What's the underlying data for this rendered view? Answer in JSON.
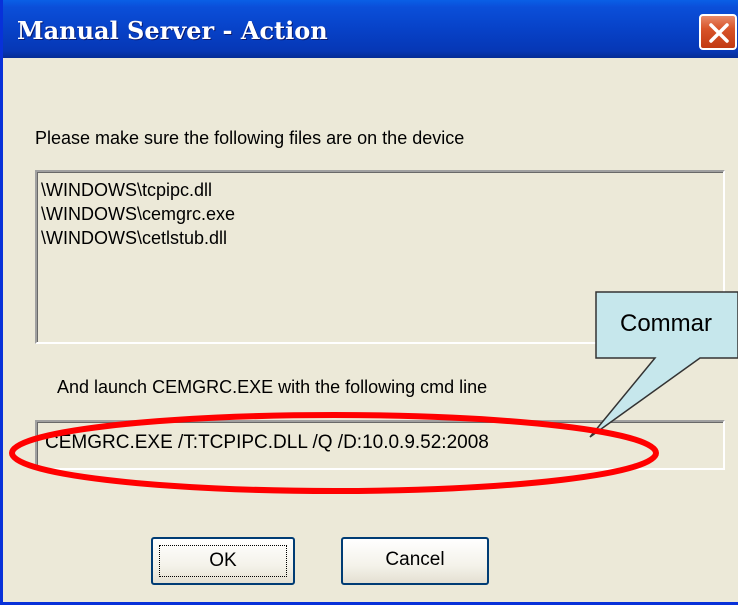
{
  "window": {
    "title": "Manual Server - Action"
  },
  "body": {
    "files_prompt": "Please make sure the following files are on the device",
    "files": [
      "\\WINDOWS\\tcpipc.dll",
      "\\WINDOWS\\cemgrc.exe",
      "\\WINDOWS\\cetlstub.dll"
    ],
    "launch_prompt": "And launch CEMGRC.EXE with the following cmd line",
    "command_line": "CEMGRC.EXE /T:TCPIPC.DLL /Q  /D:10.0.9.52:2008"
  },
  "buttons": {
    "ok_label": "OK",
    "cancel_label": "Cancel"
  },
  "annotation": {
    "callout_text": "Commar",
    "ellipse_color": "#ff0000",
    "callout_fill": "#c6e7ec"
  },
  "icons": {
    "close": "close-icon"
  }
}
